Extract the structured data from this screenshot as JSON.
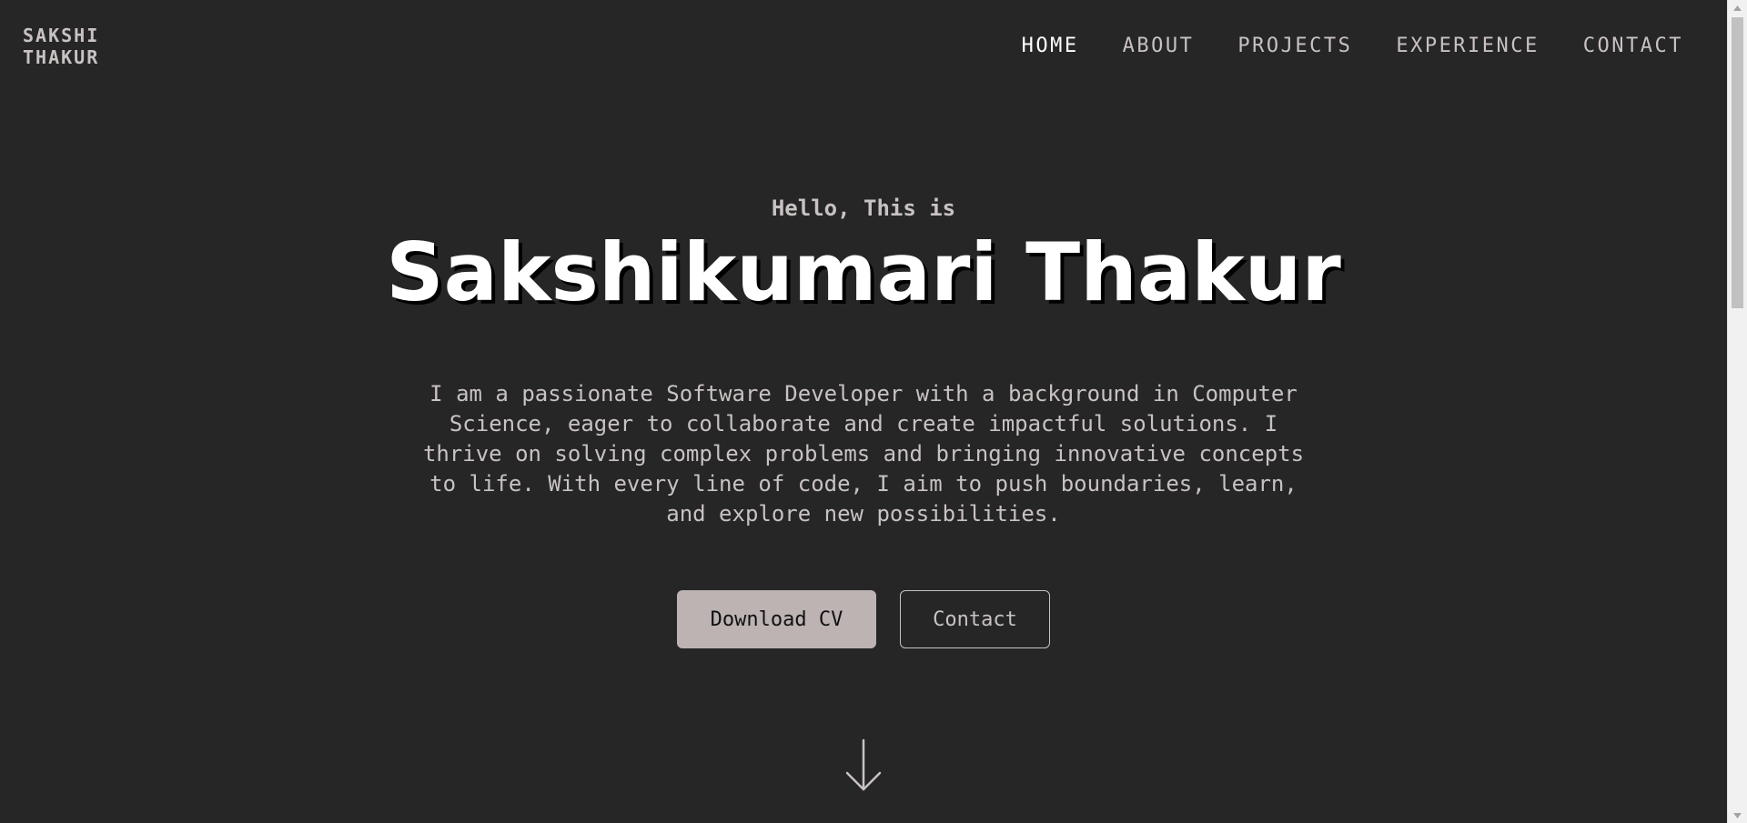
{
  "header": {
    "logo_line1": "SAKSHI",
    "logo_line2": "THAKUR",
    "nav": [
      {
        "label": "HOME",
        "active": true
      },
      {
        "label": "ABOUT"
      },
      {
        "label": "PROJECTS"
      },
      {
        "label": "EXPERIENCE"
      },
      {
        "label": "CONTACT"
      }
    ]
  },
  "hero": {
    "greeting": "Hello, This is",
    "name": "Sakshikumari Thakur",
    "bio": "I am a passionate Software Developer with a background in Computer Science, eager to collaborate and create impactful solutions. I thrive on solving complex problems and bringing innovative concepts to life. With every line of code, I aim to push boundaries, learn, and explore new possibilities.",
    "primary_button": "Download CV",
    "secondary_button": "Contact",
    "scroll_icon": "arrow-down-icon"
  },
  "colors": {
    "background": "#262626",
    "text": "#c9c2c2",
    "heading": "#ffffff",
    "button_fill": "#bdb3b3"
  }
}
